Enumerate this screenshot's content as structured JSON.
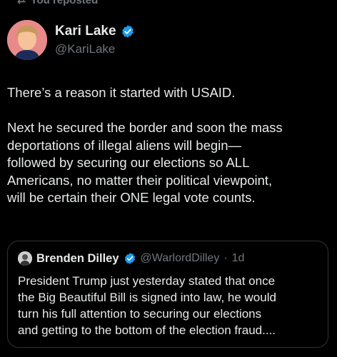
{
  "repost_label": "You reposted",
  "author": {
    "display_name": "Kari Lake",
    "handle": "@KariLake",
    "verified": true,
    "verified_color": "#1d9bf0"
  },
  "tweet": {
    "lines": [
      "There’s a reason it started with USAID.",
      "",
      "Next he secured the border and soon the mass",
      "deportations of  illegal aliens will begin—",
      "followed by securing our elections so ALL",
      "Americans, no matter their political viewpoint,",
      "will be certain their ONE legal vote counts."
    ]
  },
  "quoted": {
    "display_name": "Brenden Dilley",
    "handle": "@WarlordDilley",
    "separator": "·",
    "time": "1d",
    "verified": true,
    "lines": [
      "President Trump just yesterday stated that once",
      "the Big Beautiful Bill is signed into law, he would",
      "turn his full attention to securing our elections",
      "and getting to the bottom of the election fraud...."
    ]
  }
}
